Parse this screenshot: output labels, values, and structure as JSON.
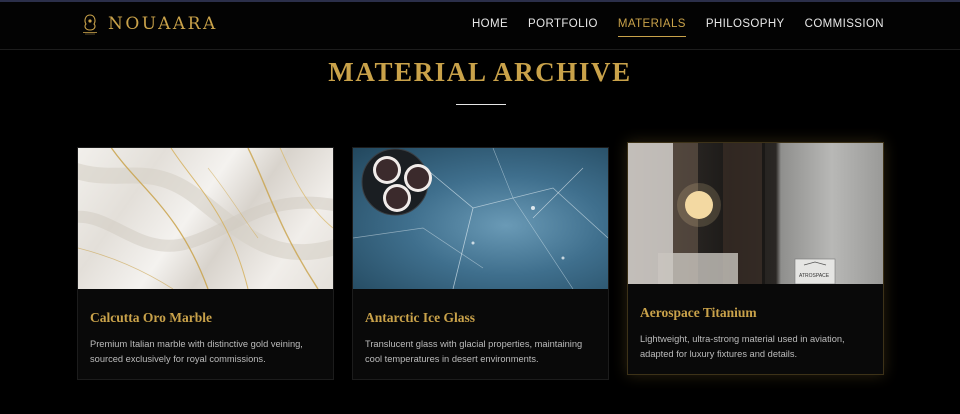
{
  "brand": {
    "name": "NOUAARA",
    "accent": "#c9a24a"
  },
  "nav": {
    "items": [
      {
        "label": "HOME",
        "active": false
      },
      {
        "label": "PORTFOLIO",
        "active": false
      },
      {
        "label": "MATERIALS",
        "active": true
      },
      {
        "label": "PHILOSOPHY",
        "active": false
      },
      {
        "label": "COMMISSION",
        "active": false
      }
    ]
  },
  "section": {
    "title": "MATERIAL ARCHIVE"
  },
  "cards": [
    {
      "title": "Calcutta Oro Marble",
      "description": "Premium Italian marble with distinctive gold veining, sourced exclusively for royal commissions."
    },
    {
      "title": "Antarctic Ice Glass",
      "description": "Translucent glass with glacial properties, maintaining cool temperatures in desert environments."
    },
    {
      "title": "Aerospace Titanium",
      "description": "Lightweight, ultra-strong material used in aviation, adapted for luxury fixtures and details.",
      "plaque_text": "ATROSPACE"
    }
  ]
}
